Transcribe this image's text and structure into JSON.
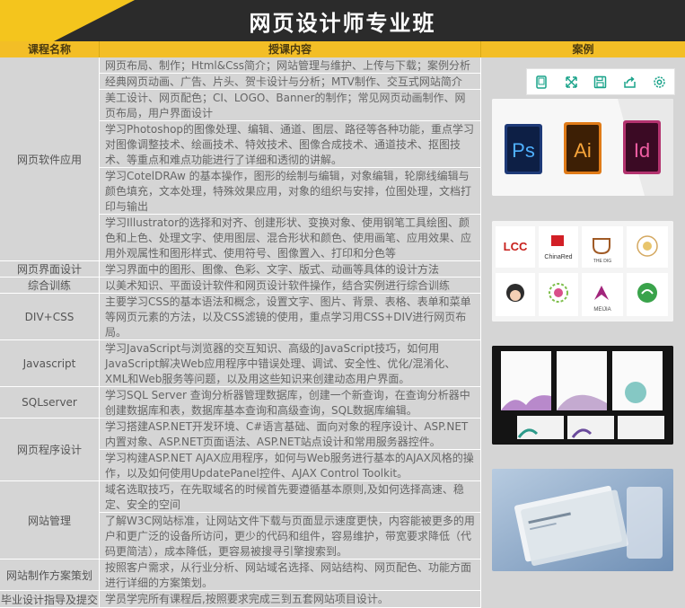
{
  "banner": {
    "title": "网页设计师专业班"
  },
  "headers": {
    "course": "课程名称",
    "content": "授课内容",
    "case": "案例"
  },
  "rows": [
    {
      "name": "网页软件应用",
      "contents": [
        "网页布局、制作；Html&Css简介；网站管理与维护、上传与下载；案例分析",
        "经典网页动画、广告、片头、贺卡设计与分析；MTV制作、交互式网站简介",
        "美工设计、网页配色；CI、LOGO、Banner的制作；常见网页动画制作、网页布局，用户界面设计",
        "学习Photoshop的图像处理、编辑、通道、图层、路径等各种功能，重点学习对图像调整技术、绘画技术、特效技术、图像合成技术、通道技术、抠图技术、等重点和难点功能进行了详细和透彻的讲解。",
        "学习CotelDRAw 的基本操作，图形的绘制与编辑，对象编辑，轮廓线编辑与颜色填充，文本处理，特殊效果应用，对象的组织与安排，位图处理，文档打印与输出",
        "学习Illustrator的选择和对齐、创建形状、变换对象、使用钢笔工具绘图、颜色和上色、处理文字、使用图层、混合形状和颜色、使用画笔、应用效果、应用外观属性和图形样式、使用符号、图像置入、打印和分色等"
      ]
    },
    {
      "name": "网页界面设计",
      "contents": [
        "学习界面中的图形、图像、色彩、文字、版式、动画等具体的设计方法"
      ]
    },
    {
      "name": "综合训练",
      "contents": [
        "以美术知识、平面设计软件和网页设计软件操作，结合实例进行综合训练"
      ]
    },
    {
      "name": "DIV+CSS",
      "contents": [
        "主要学习CSS的基本语法和概念，设置文字、图片、背景、表格、表单和菜单等网页元素的方法，以及CSS滤镜的使用，重点学习用CSS+DIV进行网页布局。"
      ]
    },
    {
      "name": "Javascript",
      "contents": [
        "学习JavaScript与浏览器的交互知识、高级的JavaScript技巧，如何用JavaScript解决Web应用程序中错误处理、调试、安全性、优化/混淆化、XML和Web服务等问题，以及用这些知识来创建动态用户界面。"
      ]
    },
    {
      "name": "SQLserver",
      "contents": [
        "学习SQL Server 查询分析器管理数据库，创建一个新查询，在查询分析器中创建数据库和表，数据库基本查询和高级查询，SQL数据库编辑。"
      ]
    },
    {
      "name": "网页程序设计",
      "contents": [
        "学习搭建ASP.NET开发环境、C#语言基础、面向对象的程序设计、ASP.NET内置对象、ASP.NET页面语法、ASP.NET站点设计和常用服务器控件。",
        "学习构建ASP.NET AJAX应用程序，如何与Web服务进行基本的AJAX风格的操作，以及如何使用UpdatePanel控件、AJAX Control Toolkit。"
      ]
    },
    {
      "name": "网站管理",
      "contents": [
        "域名选取技巧，在先取域名的时候首先要遵循基本原则,及如何选择高速、稳定、安全的空间",
        "了解W3C网站标准，让网站文件下载与页面显示速度更快，内容能被更多的用户和更广泛的设备所访问，更少的代码和组件，容易维护，带宽要求降低（代码更简洁），成本降低，更容易被搜寻引擎搜索到。"
      ]
    },
    {
      "name": "网站制作方案策划",
      "contents": [
        "按照客户需求，从行业分析、网站域名选择、网站结构、网页配色、功能方面进行详细的方案策划。"
      ]
    },
    {
      "name": "毕业设计指导及提交",
      "contents": [
        "学员学完所有课程后,按照要求完成三到五套网站项目设计。"
      ]
    }
  ],
  "toolbar": {
    "icons": [
      "phone-icon",
      "expand-icon",
      "save-icon",
      "share-icon",
      "settings-icon"
    ]
  },
  "cases": {
    "ps": {
      "labels": [
        "Ps",
        "Ai",
        "Id"
      ]
    },
    "logos": {
      "labels": [
        "LCC",
        "ChinaRed",
        "THE DIG",
        "",
        "",
        "",
        "MEIJIA",
        ""
      ]
    }
  },
  "colors": {
    "banner_bg": "#2b2b2b",
    "banner_accent": "#f4c51d",
    "header_bg": "#f3be26",
    "cell_bg": "#d5d5d5",
    "ps_blue": "#1e3a78",
    "ai_orange": "#e07b18",
    "id_pink": "#b3336f"
  }
}
